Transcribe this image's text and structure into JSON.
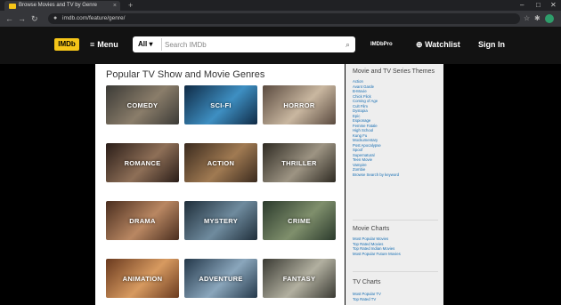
{
  "browser": {
    "tab_title": "Browse Movies and TV by Genre",
    "url": "imdb.com/feature/genre/",
    "new_tab_label": "+",
    "close_tab_label": "×"
  },
  "nav": {
    "logo": "IMDb",
    "menu": "Menu",
    "search_category": "All",
    "search_placeholder": "Search IMDb",
    "imdbpro": "IMDbPro",
    "watchlist": "Watchlist",
    "signin": "Sign In"
  },
  "main": {
    "title": "Popular TV Show and Movie Genres",
    "genres": [
      {
        "label": "COMEDY",
        "color_a": "#3b3a36",
        "color_b": "#8a7d6a"
      },
      {
        "label": "SCI-FI",
        "color_a": "#0f2a45",
        "color_b": "#3e8fc2"
      },
      {
        "label": "HORROR",
        "color_a": "#5a4a3f",
        "color_b": "#c9b7a0"
      },
      {
        "label": "ROMANCE",
        "color_a": "#2a1d18",
        "color_b": "#8e6f57"
      },
      {
        "label": "ACTION",
        "color_a": "#3a2a1e",
        "color_b": "#a07a52"
      },
      {
        "label": "THRILLER",
        "color_a": "#2e2a22",
        "color_b": "#9d9483"
      },
      {
        "label": "DRAMA",
        "color_a": "#4a2e1f",
        "color_b": "#b98762"
      },
      {
        "label": "MYSTERY",
        "color_a": "#1f2e3a",
        "color_b": "#6f8b9e"
      },
      {
        "label": "CRIME",
        "color_a": "#2b3a2c",
        "color_b": "#7f8f6c"
      },
      {
        "label": "ANIMATION",
        "color_a": "#6a3a1f",
        "color_b": "#d79a60"
      },
      {
        "label": "ADVENTURE",
        "color_a": "#24384a",
        "color_b": "#8aa6bc"
      },
      {
        "label": "FANTASY",
        "color_a": "#3a3a33",
        "color_b": "#b2b0a0"
      }
    ]
  },
  "sidebar": {
    "themes_title": "Movie and TV Series Themes",
    "themes": [
      "Action",
      "Avant Garde",
      "B-Movie",
      "Chick Flick",
      "Coming of Age",
      "Cult Film",
      "Dystopia",
      "Epic",
      "Espionage",
      "Femme Fatale",
      "High School",
      "Kung Fu",
      "Mockumentary",
      "Post Apocalypse",
      "Spoof",
      "Supernatural",
      "Teen Movie",
      "Vampire",
      "Zombie",
      "Browse Search by keyword"
    ],
    "movie_charts_title": "Movie Charts",
    "movie_charts": [
      "Most Popular Movies",
      "Top Rated Movies",
      "Top Rated Indian Movies",
      "Most Popular Future Movies"
    ],
    "tv_charts_title": "TV Charts",
    "tv_charts": [
      "Most Popular TV",
      "Top Rated TV"
    ]
  }
}
